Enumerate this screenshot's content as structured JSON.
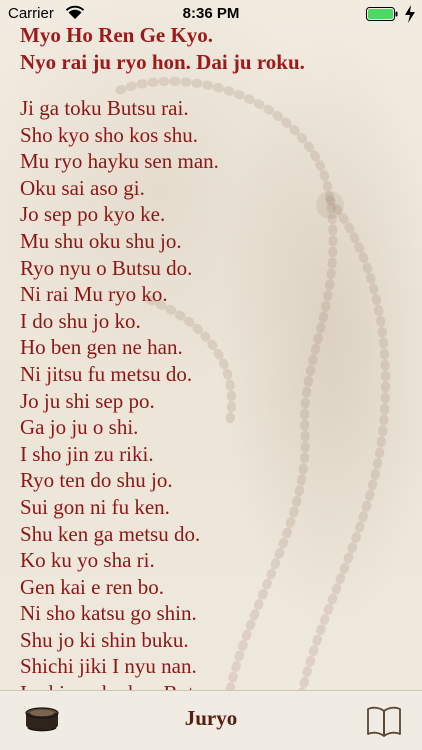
{
  "status_bar": {
    "carrier": "Carrier",
    "time": "8:36 PM"
  },
  "heading": {
    "line1": "Myo Ho Ren Ge Kyo.",
    "line2": "Nyo rai ju ryo hon. Dai ju roku."
  },
  "verses": [
    "Ji ga toku Butsu rai.",
    "Sho kyo sho kos shu.",
    "Mu ryo hayku sen man.",
    "Oku sai aso gi.",
    "Jo sep po kyo ke.",
    "Mu shu oku shu jo.",
    "Ryo nyu o Butsu do.",
    "Ni rai Mu ryo ko.",
    "I do shu jo ko.",
    "Ho ben gen ne han.",
    "Ni jitsu fu metsu do.",
    "Jo ju shi sep po.",
    "Ga jo ju o shi.",
    "I sho jin zu riki.",
    "Ryo ten do shu jo.",
    "Sui gon ni fu ken.",
    "Shu ken ga metsu do.",
    "Ko ku yo sha ri.",
    "Gen kai e ren bo.",
    "Ni sho katsu go shin.",
    "Shu jo ki shin buku.",
    "Shichi jiki I nyu nan.",
    "Is shin yoku ken Butsu"
  ],
  "tab_bar": {
    "title": "Juryo",
    "left_icon": "bell-icon",
    "right_icon": "book-icon"
  },
  "colors": {
    "text_red": "#8f1616",
    "title_brown": "#5a1c0e",
    "battery_green": "#4cd964"
  }
}
